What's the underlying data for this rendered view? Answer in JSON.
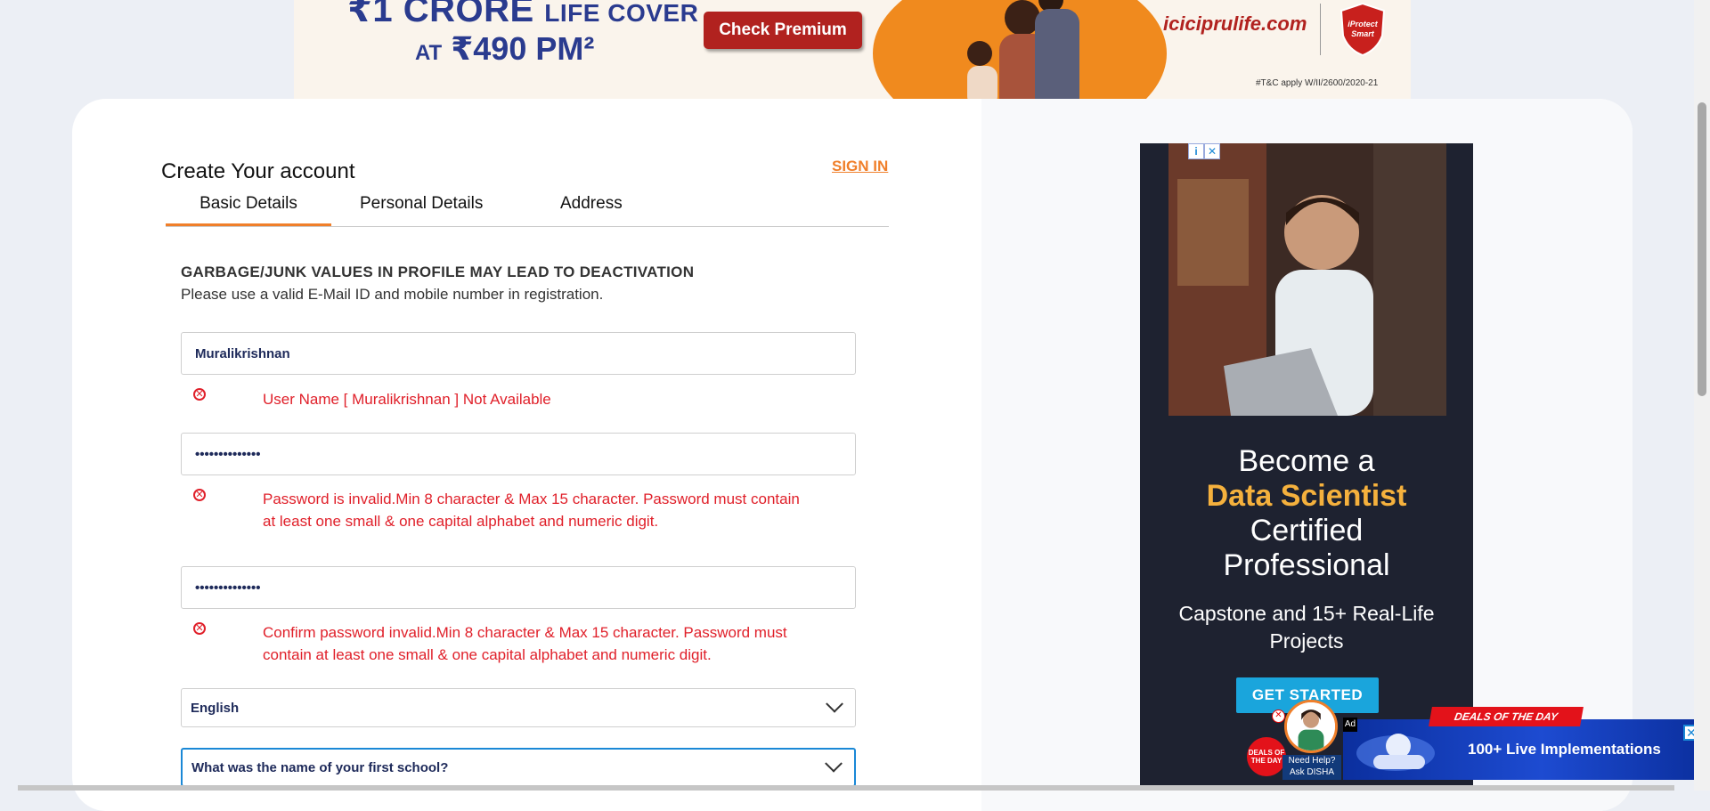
{
  "top_banner": {
    "headline_prefix": "₹1 CRORE",
    "headline_suffix": "LIFE COVER",
    "price_prefix": "AT",
    "price": "₹490 PM²",
    "cta": "Check Premium",
    "site": "iciciprulife.com",
    "logo_text": "iProtect Smart",
    "fine_print": "#T&C apply W/II/2600/2020-21"
  },
  "form": {
    "title": "Create Your account",
    "signin_label": "SIGN IN",
    "tabs": [
      {
        "label": "Basic Details",
        "active": true
      },
      {
        "label": "Personal Details",
        "active": false
      },
      {
        "label": "Address",
        "active": false
      }
    ],
    "warning_title": "GARBAGE/JUNK VALUES IN PROFILE MAY LEAD TO DEACTIVATION",
    "warning_sub": "Please use a valid E-Mail ID and mobile number in registration.",
    "username": {
      "value": "Muralikrishnan",
      "error": "User Name [ Muralikrishnan ] Not Available"
    },
    "password": {
      "value": "••••••••••••••",
      "error": "Password is invalid.Min 8 character & Max 15 character. Password must contain at least one small & one capital alphabet and numeric digit."
    },
    "confirm_password": {
      "value": "••••••••••••••",
      "error": "Confirm password invalid.Min 8 character & Max 15 character. Password must contain at least one small & one capital alphabet and numeric digit."
    },
    "language": {
      "selected": "English"
    },
    "security_question": {
      "selected": "What was the name of your first school?"
    }
  },
  "side_ad": {
    "line1": "Become a",
    "line2": "Data Scientist",
    "line3": "Certified",
    "line4": "Professional",
    "body": "Capstone and 15+ Real-Life Projects",
    "cta": "GET STARTED"
  },
  "overlay": {
    "deals_badge": "DEALS OF THE DAY",
    "ribbon": "DEALS OF THE DAY",
    "ad_label": "Ad",
    "disha_help_1": "Need Help?",
    "disha_help_2": "Ask DISHA",
    "banner_text": "100+ Live Implementations"
  },
  "colors": {
    "accent": "#f07f2a",
    "error": "#e0202a",
    "focus": "#1a88d6"
  }
}
